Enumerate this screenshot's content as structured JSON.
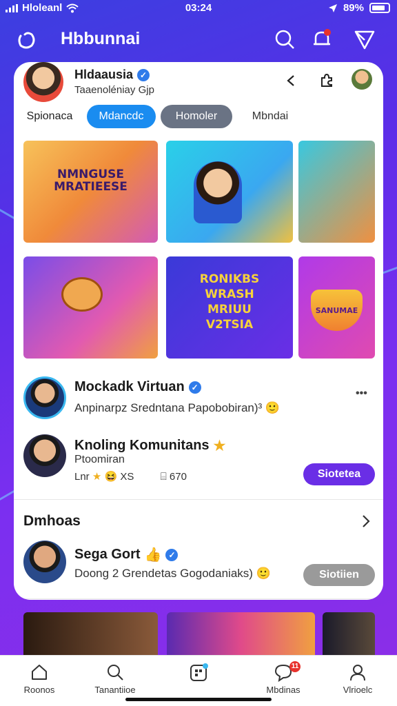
{
  "status_bar": {
    "carrier": "Hloleanl",
    "time": "03:24",
    "battery": "89%"
  },
  "header": {
    "title": "Hbbunnai"
  },
  "profile": {
    "name": "Hldaausia",
    "subtitle": "Taaenoléniay  Gjp"
  },
  "tabs": [
    {
      "label": "Spionaca",
      "state": "plain"
    },
    {
      "label": "Mdancdc",
      "state": "active"
    },
    {
      "label": "Homoler",
      "state": "grey"
    },
    {
      "label": "Mbndai",
      "state": "plain"
    }
  ],
  "tiles": {
    "t1": {
      "caption": "NMNGUSE\nMRATIEESE"
    },
    "t5": {
      "caption": "RONIKBS\nWRASH\nMRIUU\nV2TSIA"
    },
    "t6": {
      "caption": "SANUMAE"
    }
  },
  "posts": [
    {
      "name": "Mockadk Virtuan",
      "text": "Anpinarpz   Sredntana Papobobiran)³",
      "more": "•••"
    },
    {
      "name": "Knoling Komunitans",
      "line2": "Ptoomiran",
      "stats_left": "Lnr",
      "stats_mid": "XS",
      "stats_right": "670",
      "button": "Siotetea"
    }
  ],
  "section": {
    "title": "Dmhoas",
    "post_name": "Sega Gort",
    "post_text": "Doong   2  Grendetas Gogodaniaks)",
    "button": "Siotiien"
  },
  "nav": [
    {
      "label": "Roonos",
      "icon": "home-icon"
    },
    {
      "label": "Tanantiioe",
      "icon": "search-icon"
    },
    {
      "label": "",
      "icon": "create-icon"
    },
    {
      "label": "Mbdinas",
      "icon": "chat-icon",
      "badge": "11"
    },
    {
      "label": "Vlrioelc",
      "icon": "profile-icon"
    }
  ],
  "colors": {
    "accent": "#2f7bea",
    "purple": "#6a2ee6",
    "grey_btn": "#9a9a9a",
    "active_tab": "#1a8cf0"
  }
}
